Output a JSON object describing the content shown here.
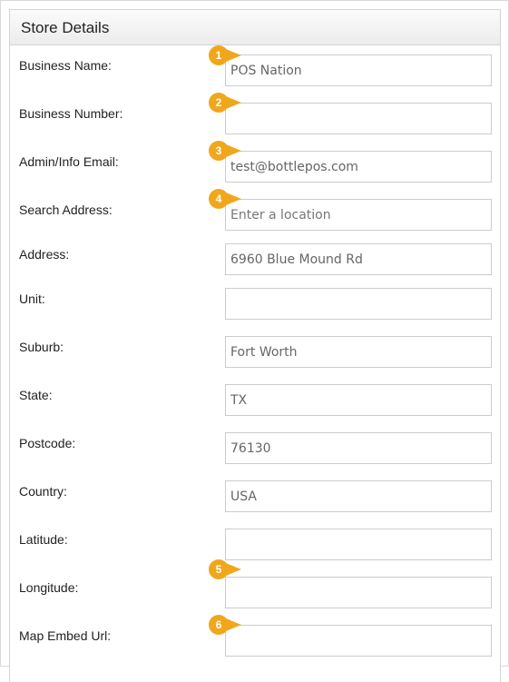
{
  "panel": {
    "title": "Store Details"
  },
  "fields": {
    "business_name": {
      "label": "Business Name:",
      "value": "POS Nation",
      "placeholder": ""
    },
    "business_number": {
      "label": "Business Number:",
      "value": "",
      "placeholder": ""
    },
    "admin_email": {
      "label": "Admin/Info Email:",
      "value": "test@bottlepos.com",
      "placeholder": ""
    },
    "search_address": {
      "label": "Search Address:",
      "value": "",
      "placeholder": "Enter a location"
    },
    "address": {
      "label": "Address:",
      "value": "6960 Blue Mound Rd",
      "placeholder": ""
    },
    "unit": {
      "label": "Unit:",
      "value": "",
      "placeholder": ""
    },
    "suburb": {
      "label": "Suburb:",
      "value": "Fort Worth",
      "placeholder": ""
    },
    "state": {
      "label": "State:",
      "value": "TX",
      "placeholder": ""
    },
    "postcode": {
      "label": "Postcode:",
      "value": "76130",
      "placeholder": ""
    },
    "country": {
      "label": "Country:",
      "value": "USA",
      "placeholder": ""
    },
    "latitude": {
      "label": "Latitude:",
      "value": "",
      "placeholder": ""
    },
    "longitude": {
      "label": "Longitude:",
      "value": "",
      "placeholder": ""
    },
    "map_embed_url": {
      "label": "Map Embed Url:",
      "value": "",
      "placeholder": ""
    }
  },
  "markers": [
    "1",
    "2",
    "3",
    "4",
    "5",
    "6"
  ],
  "colors": {
    "marker": "#f0a71b",
    "input_border": "#cccccc",
    "header_bg": "#ececec"
  }
}
